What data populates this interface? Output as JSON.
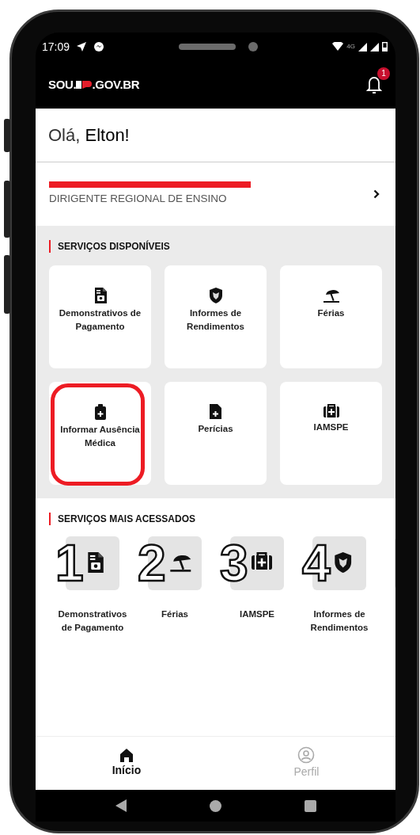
{
  "status_bar": {
    "time": "17:09",
    "network": "4G"
  },
  "header": {
    "logo_start": "SOU.",
    "logo_end": ".GOV.BR",
    "notifications": "1"
  },
  "greeting": "Olá, **Elton!**",
  "profile": {
    "redacted": true,
    "role": "DIRIGENTE REGIONAL DE ENSINO"
  },
  "services": {
    "title": "SERVIÇOS DISPONÍVEIS",
    "items": [
      {
        "kind": "payslip",
        "label": "Demonstrativos de Pagamento",
        "highlighted": false
      },
      {
        "kind": "lion",
        "label": "Informes de Rendimentos",
        "highlighted": false
      },
      {
        "kind": "beach",
        "label": "Férias",
        "highlighted": false
      },
      {
        "kind": "clipboard",
        "label": "Informar Ausência Médica",
        "highlighted": true
      },
      {
        "kind": "document",
        "label": "Perícias",
        "highlighted": false
      },
      {
        "kind": "medkit",
        "label": "IAMSPE",
        "highlighted": false
      }
    ]
  },
  "most_accessed": {
    "title": "SERVIÇOS MAIS ACESSADOS",
    "items": [
      {
        "rank": "1",
        "kind": "payslip",
        "label": "Demonstrativos de Pagamento"
      },
      {
        "rank": "2",
        "kind": "beach",
        "label": "Férias"
      },
      {
        "rank": "3",
        "kind": "medkit",
        "label": "IAMSPE"
      },
      {
        "rank": "4",
        "kind": "lion",
        "label": "Informes de Rendimentos"
      },
      {
        "kind": "partial"
      }
    ]
  },
  "bottom_nav": [
    {
      "kind": "home",
      "label": "Início",
      "selected": true
    },
    {
      "kind": "person",
      "label": "Perfil",
      "selected": false
    }
  ]
}
